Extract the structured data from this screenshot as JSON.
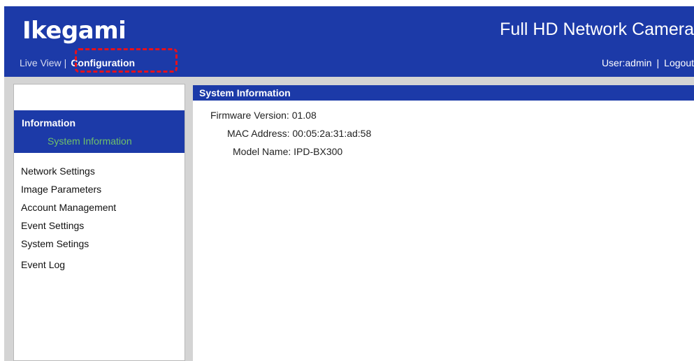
{
  "header": {
    "logo": "Ikegami",
    "product_title": "Full HD Network Camera",
    "nav": {
      "live_view": "Live View",
      "separator": "|",
      "configuration": "Configuration"
    },
    "user": "User:admin",
    "user_separator": "|",
    "logout": "Logout"
  },
  "sidebar": {
    "active_group": {
      "title": "Information",
      "sub_item": "System Information"
    },
    "items": [
      {
        "label": "Network Settings"
      },
      {
        "label": "Image Parameters"
      },
      {
        "label": "Account Management"
      },
      {
        "label": "Event Settings"
      },
      {
        "label": "System Setings"
      },
      {
        "label": "Event Log"
      }
    ]
  },
  "main": {
    "title": "System Information",
    "fields": [
      {
        "label": "Firmware Version:",
        "value": "01.08"
      },
      {
        "label": "MAC Address:",
        "value": "00:05:2a:31:ad:58"
      },
      {
        "label": "Model Name:",
        "value": "IPD-BX300"
      }
    ]
  },
  "colors": {
    "brand_blue": "#1c3aa8",
    "active_sub_green": "#6fc06a",
    "highlight_red": "#e8101a"
  }
}
